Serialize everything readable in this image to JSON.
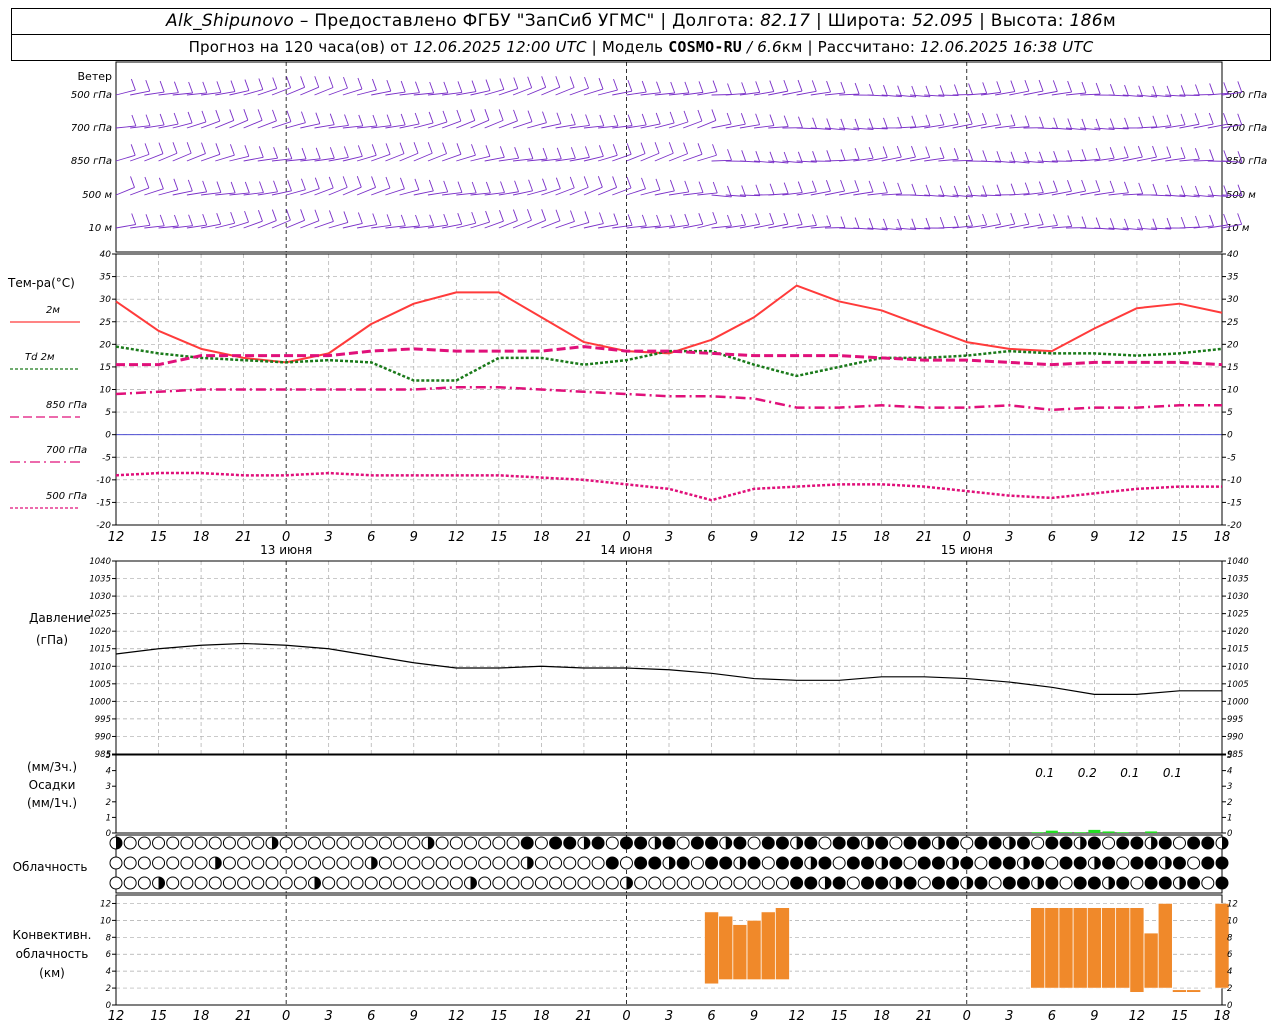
{
  "header": {
    "station": "Alk_Shipunovo",
    "provider": "– Предоставлено ФГБУ \"ЗапСиб УГМС\"",
    "lon_label": "| Долгота:",
    "lon": "82.17",
    "lat_label": "| Широта:",
    "lat": "52.095",
    "alt_label": "| Высота:",
    "alt": "186",
    "alt_unit": "м",
    "forecast_label": "Прогноз на 120 часа(ов) от",
    "forecast_time": "12.06.2025 12:00 UTC",
    "model_label": "| Модель",
    "model": "COSMO-RU",
    "resolution": "/ 6.6",
    "res_unit": "км",
    "calc_label": "| Рассчитано:",
    "calc_time": "12.06.2025 16:38 UTC"
  },
  "wind_panel": {
    "title": "Ветер",
    "levels": [
      "500 гПа",
      "700 гПа",
      "850 гПа",
      "500 м",
      "10 м"
    ]
  },
  "temp_panel": {
    "title": "Тем-ра(°С)",
    "legend": [
      {
        "label": "2м",
        "color": "#ff3b3b",
        "style": "solid"
      },
      {
        "label": "Td  2м",
        "color": "#1a7a1a",
        "style": "dotted"
      },
      {
        "label": "850 гПа",
        "color": "#e0107a",
        "style": "dashed"
      },
      {
        "label": "700 гПа",
        "color": "#e0107a",
        "style": "dashdot"
      },
      {
        "label": "500 гПа",
        "color": "#e0107a",
        "style": "dotted"
      }
    ]
  },
  "pressure_panel": {
    "title": "Давление",
    "unit": "(гПа)"
  },
  "precip_panel": {
    "unit3": "(мм/3ч.)",
    "title": "Осадки",
    "unit1": "(мм/1ч.)",
    "labels": [
      "0.1",
      "0.2",
      "0.1",
      "0.1"
    ]
  },
  "cloud_panel": {
    "title": "Облачность"
  },
  "conv_panel": {
    "title1": "Конвективн.",
    "title2": "облачность",
    "unit": "(км)"
  },
  "time_axis": {
    "hour_labels": [
      "12",
      "15",
      "18",
      "21",
      "0",
      "3",
      "6",
      "9",
      "12",
      "15",
      "18",
      "21",
      "0",
      "3",
      "6",
      "9",
      "12",
      "15",
      "18",
      "21",
      "0",
      "3",
      "6",
      "9",
      "12",
      "15",
      "18"
    ],
    "day_labels": [
      "13 июня",
      "14 июня",
      "15 июня"
    ]
  },
  "chart_data": [
    {
      "type": "line",
      "title": "Тем-ра(°С)",
      "ylim": [
        -20,
        40
      ],
      "yticks": [
        -20,
        -15,
        -10,
        -5,
        0,
        5,
        10,
        15,
        20,
        25,
        30,
        35,
        40
      ],
      "x_hours": [
        0,
        3,
        6,
        9,
        12,
        15,
        18,
        21,
        24,
        27,
        30,
        33,
        36,
        39,
        42,
        45,
        48,
        51,
        54,
        57,
        60,
        63,
        66,
        69,
        72,
        75,
        78
      ],
      "series": [
        {
          "name": "2м",
          "color": "#ff3b3b",
          "values": [
            29.5,
            23,
            19,
            17,
            16,
            18,
            24.5,
            29,
            31.5,
            31.5,
            26,
            20.5,
            18.5,
            18,
            21,
            26,
            33,
            29.5,
            27.5,
            24,
            20.5,
            19,
            18.5,
            23.5,
            28,
            29,
            27
          ]
        },
        {
          "name": "Td  2м",
          "color": "#1a7a1a",
          "values": [
            19.5,
            18,
            17,
            16.5,
            16,
            16.5,
            16,
            12,
            12,
            17,
            17,
            15.5,
            16.5,
            18.5,
            18.5,
            15.5,
            13,
            15,
            17,
            17,
            17.5,
            18.5,
            18,
            18,
            17.5,
            18,
            19
          ]
        },
        {
          "name": "850 гПа",
          "color": "#e0107a",
          "values": [
            15.5,
            15.5,
            17.5,
            17.5,
            17.5,
            17.5,
            18.5,
            19,
            18.5,
            18.5,
            18.5,
            19.5,
            18.5,
            18.5,
            18,
            17.5,
            17.5,
            17.5,
            17,
            16.5,
            16.5,
            16,
            15.5,
            16,
            16,
            16,
            15.5
          ]
        },
        {
          "name": "700 гПа",
          "color": "#e0107a",
          "values": [
            9,
            9.5,
            10,
            10,
            10,
            10,
            10,
            10,
            10.5,
            10.5,
            10,
            9.5,
            9,
            8.5,
            8.5,
            8,
            6,
            6,
            6.5,
            6,
            6,
            6.5,
            5.5,
            6,
            6,
            6.5,
            6.5
          ]
        },
        {
          "name": "500 гПа",
          "color": "#e0107a",
          "values": [
            -9,
            -8.5,
            -8.5,
            -9,
            -9,
            -8.5,
            -9,
            -9,
            -9,
            -9,
            -9.5,
            -10,
            -11,
            -12,
            -14.5,
            -12,
            -11.5,
            -11,
            -11,
            -11.5,
            -12.5,
            -13.5,
            -14,
            -13,
            -12,
            -11.5,
            -11.5
          ]
        }
      ]
    },
    {
      "type": "line",
      "title": "Давление",
      "ylim": [
        985,
        1040
      ],
      "yticks": [
        985,
        990,
        995,
        1000,
        1005,
        1010,
        1015,
        1020,
        1025,
        1030,
        1035,
        1040
      ],
      "x_hours": [
        0,
        3,
        6,
        9,
        12,
        15,
        18,
        21,
        24,
        27,
        30,
        33,
        36,
        39,
        42,
        45,
        48,
        51,
        54,
        57,
        60,
        63,
        66,
        69,
        72,
        75,
        78
      ],
      "series": [
        {
          "name": "",
          "color": "#000000",
          "values": [
            1013.5,
            1015,
            1016,
            1016.5,
            1016,
            1015,
            1013,
            1011,
            1009.5,
            1009.5,
            1010,
            1009.5,
            1009.5,
            1009,
            1008,
            1006.5,
            1006,
            1006,
            1007,
            1007,
            1006.5,
            1005.5,
            1004,
            1002,
            1002,
            1003,
            1003
          ]
        }
      ]
    },
    {
      "type": "bar",
      "title": "Осадки",
      "ylim": [
        0,
        5
      ],
      "x_hours": [
        65,
        66,
        67,
        68,
        69,
        70,
        71,
        72,
        73
      ],
      "values": [
        0.05,
        0.15,
        0.05,
        0.05,
        0.2,
        0.1,
        0.05,
        0,
        0.1
      ]
    },
    {
      "type": "bar",
      "title": "Конвективн. облачность",
      "ylim": [
        0,
        13
      ],
      "yticks": [
        0,
        2,
        4,
        6,
        8,
        10,
        12
      ],
      "x_hours": [
        42,
        43,
        44,
        45,
        46,
        47,
        65,
        66,
        67,
        68,
        69,
        70,
        71,
        72,
        73,
        74,
        75,
        76,
        77,
        78
      ],
      "bottoms": [
        2.5,
        3,
        3,
        3,
        3,
        3,
        2,
        2,
        2,
        2,
        2,
        2,
        2,
        1.5,
        2,
        2,
        1.5,
        1.5,
        2,
        2
      ],
      "tops": [
        11,
        10.5,
        9.5,
        10,
        11,
        11.5,
        11.5,
        11.5,
        11.5,
        11.5,
        11.5,
        11.5,
        11.5,
        11.5,
        8.5,
        12,
        1.8,
        1.8,
        0,
        12
      ]
    }
  ]
}
